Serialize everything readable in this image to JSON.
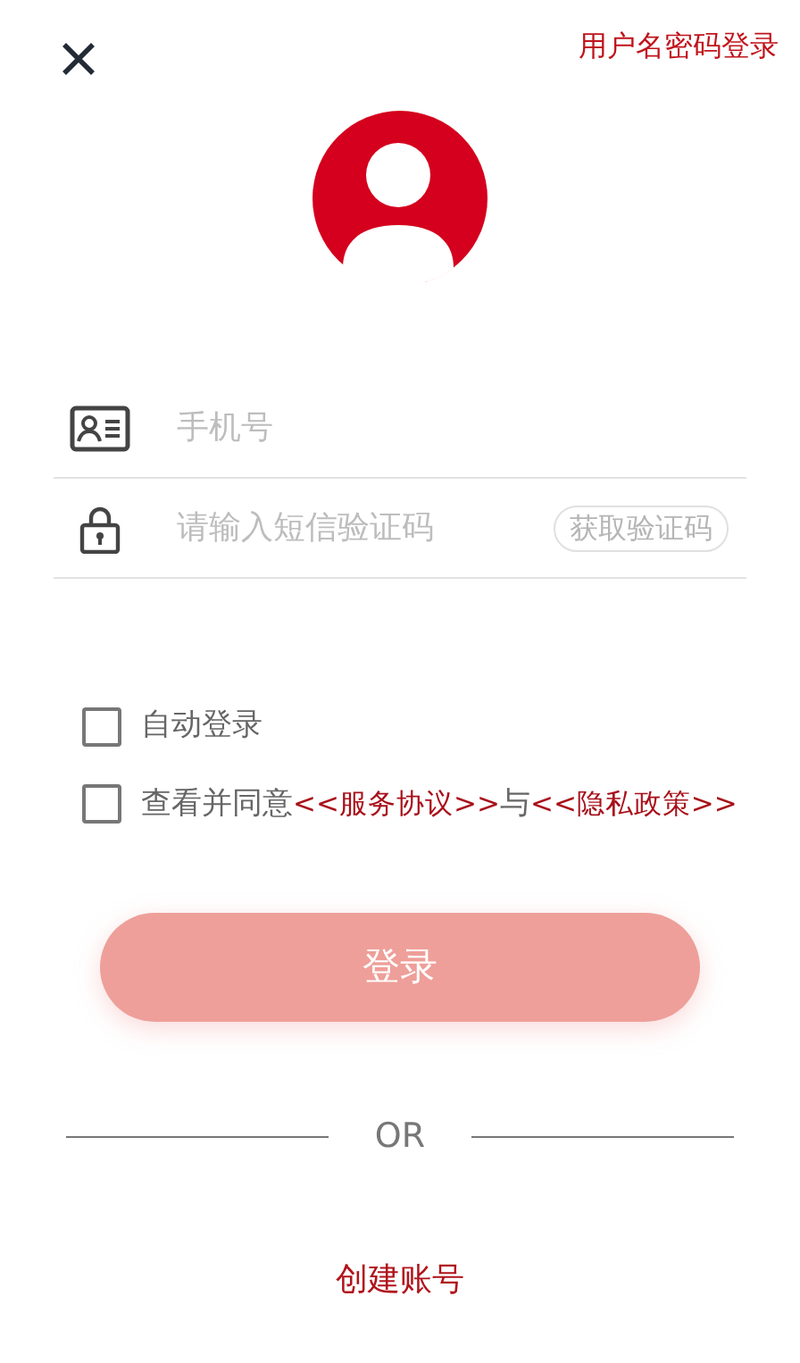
{
  "header": {
    "switch_link": "用户名密码登录"
  },
  "fields": [
    {
      "kind": "phone",
      "placeholder": "手机号"
    },
    {
      "kind": "code",
      "placeholder": "请输入短信验证码",
      "action": "获取验证码"
    }
  ],
  "options": [
    {
      "checked": false,
      "parts": [
        {
          "kind": "text",
          "text": "自动登录"
        }
      ]
    },
    {
      "checked": false,
      "parts": [
        {
          "kind": "text",
          "text": "查看并同意"
        },
        {
          "kind": "link",
          "text": "<<服务协议>>"
        },
        {
          "kind": "text",
          "text": "与"
        },
        {
          "kind": "link",
          "text": "<<隐私政策>>"
        }
      ]
    }
  ],
  "login_button": {
    "label": "登录",
    "disabled": true
  },
  "divider_text": "OR",
  "create_account": "创建账号"
}
